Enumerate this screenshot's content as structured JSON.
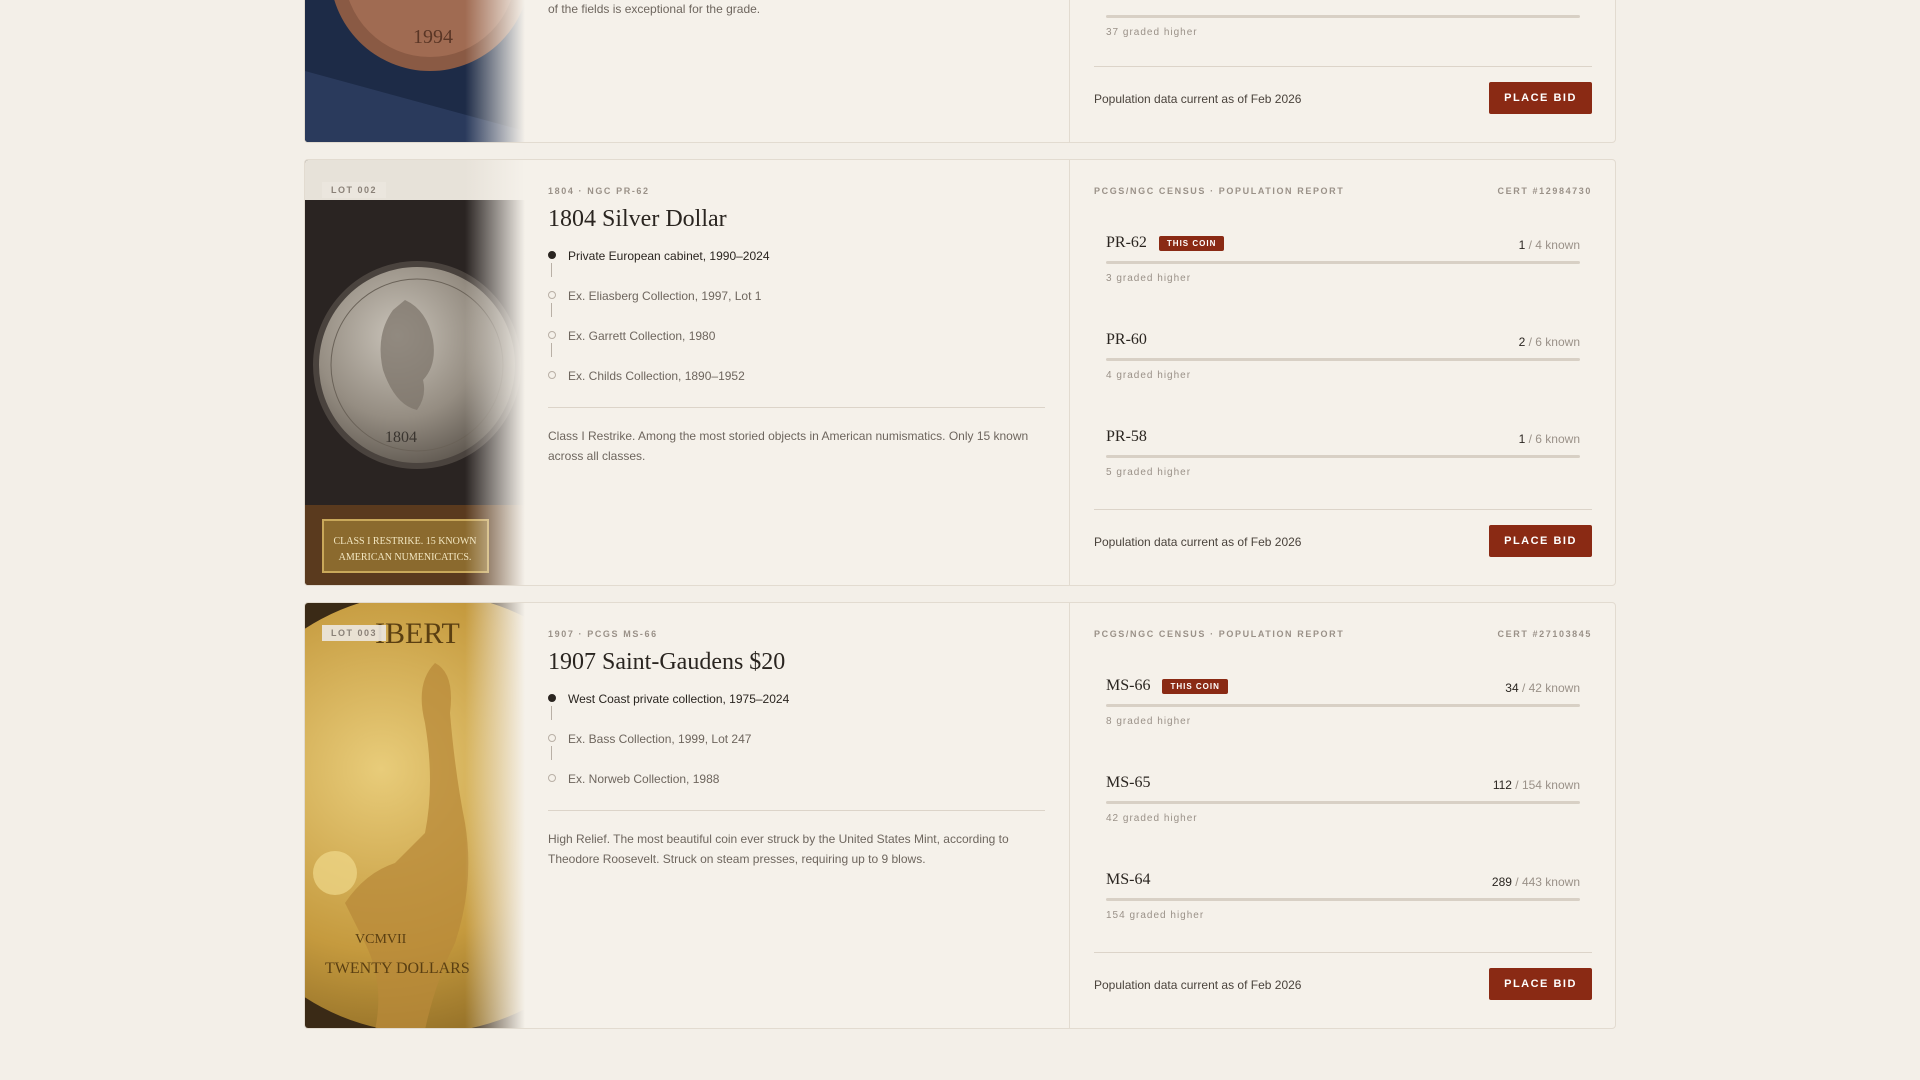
{
  "lots": [
    {
      "lot": "",
      "kicker": "",
      "title": "",
      "provenance": [],
      "description": "of the fields is exceptional for the grade.",
      "census_header": "",
      "cert": "",
      "grades": [
        {
          "grade": "",
          "this_coin": false,
          "count": "",
          "known": "",
          "higher": "37 graded higher",
          "fill": 0
        }
      ],
      "footer_note": "Population data current as of Feb 2026",
      "bid_label": "PLACE BID",
      "image_label": "1994"
    },
    {
      "lot": "LOT 002",
      "kicker": "1804 · NGC PR-62",
      "title": "1804 Silver Dollar",
      "provenance": [
        {
          "text": "Private European cabinet, 1990–2024",
          "current": true
        },
        {
          "text": "Ex. Eliasberg Collection, 1997, Lot 1",
          "current": false
        },
        {
          "text": "Ex. Garrett Collection, 1980",
          "current": false
        },
        {
          "text": "Ex. Childs Collection, 1890–1952",
          "current": false
        }
      ],
      "description": "Class I Restrike. Among the most storied objects in American numismatics. Only 15 known across all classes.",
      "census_header": "PCGS/NGC CENSUS · POPULATION REPORT",
      "cert": "CERT #12984730",
      "grades": [
        {
          "grade": "PR-62",
          "this_coin": true,
          "tag": "THIS COIN",
          "count": "1",
          "known": " / 4 known",
          "higher": "3 graded higher",
          "fill": 0
        },
        {
          "grade": "PR-60",
          "this_coin": false,
          "count": "2",
          "known": " / 6 known",
          "higher": "4 graded higher",
          "fill": 0
        },
        {
          "grade": "PR-58",
          "this_coin": false,
          "count": "1",
          "known": " / 6 known",
          "higher": "5 graded higher",
          "fill": 0
        }
      ],
      "footer_note": "Population data current as of Feb 2026",
      "bid_label": "PLACE BID",
      "image_label": "CLASS I RESTRIKE. 15 KNOWN AMERICAN NUMENICATICS."
    },
    {
      "lot": "LOT 003",
      "kicker": "1907 · PCGS MS-66",
      "title": "1907 Saint-Gaudens $20",
      "provenance": [
        {
          "text": "West Coast private collection, 1975–2024",
          "current": true
        },
        {
          "text": "Ex. Bass Collection, 1999, Lot 247",
          "current": false
        },
        {
          "text": "Ex. Norweb Collection, 1988",
          "current": false
        }
      ],
      "description": "High Relief. The most beautiful coin ever struck by the United States Mint, according to Theodore Roosevelt. Struck on steam presses, requiring up to 9 blows.",
      "census_header": "PCGS/NGC CENSUS · POPULATION REPORT",
      "cert": "CERT #27103845",
      "grades": [
        {
          "grade": "MS-66",
          "this_coin": true,
          "tag": "THIS COIN",
          "count": "34",
          "known": " / 42 known",
          "higher": "8 graded higher",
          "fill": 0
        },
        {
          "grade": "MS-65",
          "this_coin": false,
          "count": "112",
          "known": " / 154 known",
          "higher": "42 graded higher",
          "fill": 0
        },
        {
          "grade": "MS-64",
          "this_coin": false,
          "count": "289",
          "known": " / 443 known",
          "higher": "154 graded higher",
          "fill": 0
        }
      ],
      "footer_note": "Population data current as of Feb 2026",
      "bid_label": "PLACE BID",
      "image_label": "VCMVII TWENTY DOLLARS"
    }
  ]
}
